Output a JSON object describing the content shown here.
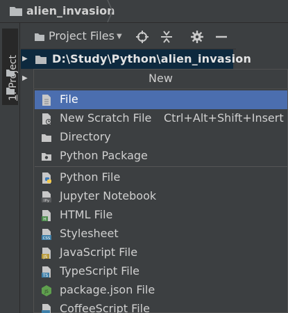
{
  "breadcrumb": {
    "folder_icon": "folder-icon",
    "text": "alien_invasion"
  },
  "side_tab": {
    "number": "1",
    "rest": ": Project"
  },
  "tool_window": {
    "title": "Project Files",
    "icons": [
      "locate-icon",
      "collapse-all-icon",
      "gear-icon",
      "minimize-icon"
    ]
  },
  "tree": {
    "root_path": "D:\\Study\\Python\\alien_invasion"
  },
  "popup": {
    "title": "New",
    "group1": [
      {
        "label": "File",
        "icon": "file-icon",
        "selected": true
      },
      {
        "label": "New Scratch File",
        "icon": "scratch-file-icon",
        "shortcut": "Ctrl+Alt+Shift+Insert"
      },
      {
        "label": "Directory",
        "icon": "folder-icon"
      },
      {
        "label": "Python Package",
        "icon": "package-icon"
      }
    ],
    "group2": [
      {
        "label": "Python File",
        "icon": "python-file-icon"
      },
      {
        "label": "Jupyter Notebook",
        "icon": "jupyter-icon",
        "badge": "IPy"
      },
      {
        "label": "HTML File",
        "icon": "html-file-icon",
        "badge": "H"
      },
      {
        "label": "Stylesheet",
        "icon": "css-file-icon",
        "badge": "CSS"
      },
      {
        "label": "JavaScript File",
        "icon": "js-file-icon",
        "badge": "JS"
      },
      {
        "label": "TypeScript File",
        "icon": "ts-file-icon",
        "badge": "TS"
      },
      {
        "label": "package.json File",
        "icon": "nodejs-icon",
        "badge": "JS"
      },
      {
        "label": "CoffeeScript File",
        "icon": "coffeescript-file-icon"
      }
    ]
  },
  "colors": {
    "background": "#3c3f41",
    "selection": "#4b6eaf",
    "tree_selection": "#0d293e",
    "text": "#d0d0d0"
  }
}
